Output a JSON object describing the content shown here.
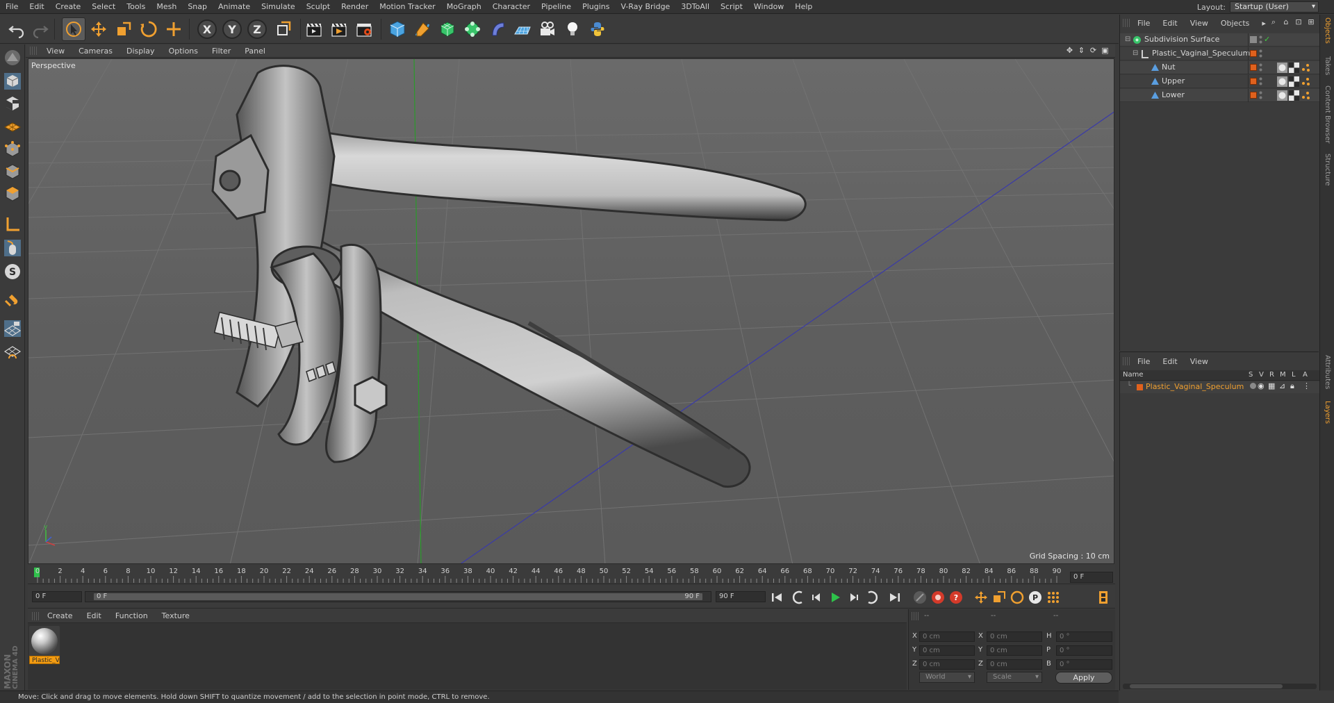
{
  "menu": {
    "items": [
      "File",
      "Edit",
      "Create",
      "Select",
      "Tools",
      "Mesh",
      "Snap",
      "Animate",
      "Simulate",
      "Sculpt",
      "Render",
      "Motion Tracker",
      "MoGraph",
      "Character",
      "Pipeline",
      "Plugins",
      "V-Ray Bridge",
      "3DToAll",
      "Script",
      "Window",
      "Help"
    ],
    "layout_label": "Layout:",
    "layout_value": "Startup (User)"
  },
  "toolbar": {
    "x_axis": "X",
    "y_axis": "Y",
    "z_axis": "Z"
  },
  "viewport": {
    "menu": [
      "View",
      "Cameras",
      "Display",
      "Options",
      "Filter",
      "Panel"
    ],
    "label": "Perspective",
    "grid_spacing": "Grid Spacing : 10 cm"
  },
  "timeline": {
    "ticks": [
      "0",
      "2",
      "4",
      "6",
      "8",
      "10",
      "12",
      "14",
      "16",
      "18",
      "20",
      "22",
      "24",
      "26",
      "28",
      "30",
      "32",
      "34",
      "36",
      "38",
      "40",
      "42",
      "44",
      "46",
      "48",
      "50",
      "52",
      "54",
      "56",
      "58",
      "60",
      "62",
      "64",
      "66",
      "68",
      "70",
      "72",
      "74",
      "76",
      "78",
      "80",
      "82",
      "84",
      "86",
      "88",
      "90"
    ],
    "current_frame_field": "0 F"
  },
  "transport": {
    "start_field": "0 F",
    "range_start": "0 F",
    "range_end": "90 F",
    "end_field": "90 F"
  },
  "materials": {
    "menu": [
      "Create",
      "Edit",
      "Function",
      "Texture"
    ],
    "items": [
      {
        "label": "Plastic_V"
      }
    ]
  },
  "coordinates": {
    "header": [
      "--",
      "--",
      "--"
    ],
    "rows": [
      {
        "pos_axis": "X",
        "pos": "0 cm",
        "size_axis": "X",
        "size": "0 cm",
        "rot_axis": "H",
        "rot": "0 °"
      },
      {
        "pos_axis": "Y",
        "pos": "0 cm",
        "size_axis": "Y",
        "size": "0 cm",
        "rot_axis": "P",
        "rot": "0 °"
      },
      {
        "pos_axis": "Z",
        "pos": "0 cm",
        "size_axis": "Z",
        "size": "0 cm",
        "rot_axis": "B",
        "rot": "0 °"
      }
    ],
    "mode_world": "World",
    "mode_scale": "Scale",
    "apply": "Apply"
  },
  "status": "Move: Click and drag to move elements. Hold down SHIFT to quantize movement / add to the selection in point mode, CTRL to remove.",
  "objects": {
    "menu": [
      "File",
      "Edit",
      "View",
      "Objects"
    ],
    "tree": [
      {
        "name": "Subdivision Surface",
        "depth": 0
      },
      {
        "name": "Plastic_Vaginal_Speculum",
        "depth": 1
      },
      {
        "name": "Nut",
        "depth": 2
      },
      {
        "name": "Upper",
        "depth": 2
      },
      {
        "name": "Lower",
        "depth": 2
      }
    ]
  },
  "layers": {
    "menu": [
      "File",
      "Edit",
      "View"
    ],
    "columns": {
      "name": "Name",
      "s": "S",
      "v": "V",
      "r": "R",
      "m": "M",
      "l": "L",
      "a": "A"
    },
    "row_name": "Plastic_Vaginal_Speculum"
  },
  "right_tabs": [
    "Objects",
    "Takes",
    "Content Browser",
    "Structure",
    "Attributes",
    "Layers"
  ],
  "brand": {
    "maxon": "MAXON",
    "cinema": "CINEMA 4D"
  },
  "colors": {
    "accent_orange": "#f0a030",
    "layer_orange": "#e0611d",
    "play_green": "#2ec24a"
  }
}
